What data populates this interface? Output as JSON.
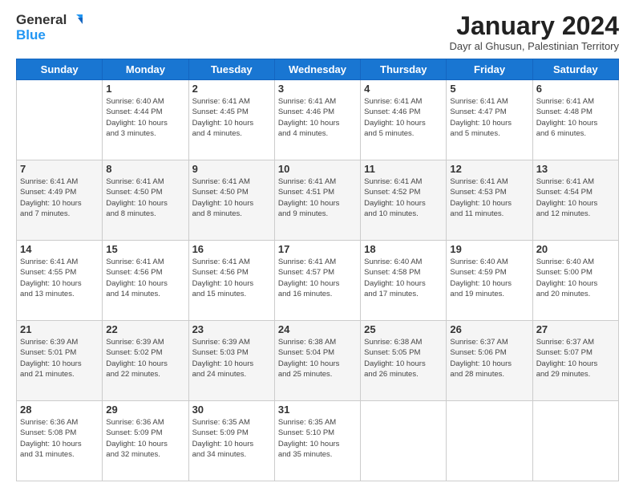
{
  "logo": {
    "line1": "General",
    "line2": "Blue"
  },
  "header": {
    "title": "January 2024",
    "subtitle": "Dayr al Ghusun, Palestinian Territory"
  },
  "days_of_week": [
    "Sunday",
    "Monday",
    "Tuesday",
    "Wednesday",
    "Thursday",
    "Friday",
    "Saturday"
  ],
  "weeks": [
    [
      {
        "day": "",
        "info": ""
      },
      {
        "day": "1",
        "info": "Sunrise: 6:40 AM\nSunset: 4:44 PM\nDaylight: 10 hours\nand 3 minutes."
      },
      {
        "day": "2",
        "info": "Sunrise: 6:41 AM\nSunset: 4:45 PM\nDaylight: 10 hours\nand 4 minutes."
      },
      {
        "day": "3",
        "info": "Sunrise: 6:41 AM\nSunset: 4:46 PM\nDaylight: 10 hours\nand 4 minutes."
      },
      {
        "day": "4",
        "info": "Sunrise: 6:41 AM\nSunset: 4:46 PM\nDaylight: 10 hours\nand 5 minutes."
      },
      {
        "day": "5",
        "info": "Sunrise: 6:41 AM\nSunset: 4:47 PM\nDaylight: 10 hours\nand 5 minutes."
      },
      {
        "day": "6",
        "info": "Sunrise: 6:41 AM\nSunset: 4:48 PM\nDaylight: 10 hours\nand 6 minutes."
      }
    ],
    [
      {
        "day": "7",
        "info": "Sunrise: 6:41 AM\nSunset: 4:49 PM\nDaylight: 10 hours\nand 7 minutes."
      },
      {
        "day": "8",
        "info": "Sunrise: 6:41 AM\nSunset: 4:50 PM\nDaylight: 10 hours\nand 8 minutes."
      },
      {
        "day": "9",
        "info": "Sunrise: 6:41 AM\nSunset: 4:50 PM\nDaylight: 10 hours\nand 8 minutes."
      },
      {
        "day": "10",
        "info": "Sunrise: 6:41 AM\nSunset: 4:51 PM\nDaylight: 10 hours\nand 9 minutes."
      },
      {
        "day": "11",
        "info": "Sunrise: 6:41 AM\nSunset: 4:52 PM\nDaylight: 10 hours\nand 10 minutes."
      },
      {
        "day": "12",
        "info": "Sunrise: 6:41 AM\nSunset: 4:53 PM\nDaylight: 10 hours\nand 11 minutes."
      },
      {
        "day": "13",
        "info": "Sunrise: 6:41 AM\nSunset: 4:54 PM\nDaylight: 10 hours\nand 12 minutes."
      }
    ],
    [
      {
        "day": "14",
        "info": "Sunrise: 6:41 AM\nSunset: 4:55 PM\nDaylight: 10 hours\nand 13 minutes."
      },
      {
        "day": "15",
        "info": "Sunrise: 6:41 AM\nSunset: 4:56 PM\nDaylight: 10 hours\nand 14 minutes."
      },
      {
        "day": "16",
        "info": "Sunrise: 6:41 AM\nSunset: 4:56 PM\nDaylight: 10 hours\nand 15 minutes."
      },
      {
        "day": "17",
        "info": "Sunrise: 6:41 AM\nSunset: 4:57 PM\nDaylight: 10 hours\nand 16 minutes."
      },
      {
        "day": "18",
        "info": "Sunrise: 6:40 AM\nSunset: 4:58 PM\nDaylight: 10 hours\nand 17 minutes."
      },
      {
        "day": "19",
        "info": "Sunrise: 6:40 AM\nSunset: 4:59 PM\nDaylight: 10 hours\nand 19 minutes."
      },
      {
        "day": "20",
        "info": "Sunrise: 6:40 AM\nSunset: 5:00 PM\nDaylight: 10 hours\nand 20 minutes."
      }
    ],
    [
      {
        "day": "21",
        "info": "Sunrise: 6:39 AM\nSunset: 5:01 PM\nDaylight: 10 hours\nand 21 minutes."
      },
      {
        "day": "22",
        "info": "Sunrise: 6:39 AM\nSunset: 5:02 PM\nDaylight: 10 hours\nand 22 minutes."
      },
      {
        "day": "23",
        "info": "Sunrise: 6:39 AM\nSunset: 5:03 PM\nDaylight: 10 hours\nand 24 minutes."
      },
      {
        "day": "24",
        "info": "Sunrise: 6:38 AM\nSunset: 5:04 PM\nDaylight: 10 hours\nand 25 minutes."
      },
      {
        "day": "25",
        "info": "Sunrise: 6:38 AM\nSunset: 5:05 PM\nDaylight: 10 hours\nand 26 minutes."
      },
      {
        "day": "26",
        "info": "Sunrise: 6:37 AM\nSunset: 5:06 PM\nDaylight: 10 hours\nand 28 minutes."
      },
      {
        "day": "27",
        "info": "Sunrise: 6:37 AM\nSunset: 5:07 PM\nDaylight: 10 hours\nand 29 minutes."
      }
    ],
    [
      {
        "day": "28",
        "info": "Sunrise: 6:36 AM\nSunset: 5:08 PM\nDaylight: 10 hours\nand 31 minutes."
      },
      {
        "day": "29",
        "info": "Sunrise: 6:36 AM\nSunset: 5:09 PM\nDaylight: 10 hours\nand 32 minutes."
      },
      {
        "day": "30",
        "info": "Sunrise: 6:35 AM\nSunset: 5:09 PM\nDaylight: 10 hours\nand 34 minutes."
      },
      {
        "day": "31",
        "info": "Sunrise: 6:35 AM\nSunset: 5:10 PM\nDaylight: 10 hours\nand 35 minutes."
      },
      {
        "day": "",
        "info": ""
      },
      {
        "day": "",
        "info": ""
      },
      {
        "day": "",
        "info": ""
      }
    ]
  ]
}
